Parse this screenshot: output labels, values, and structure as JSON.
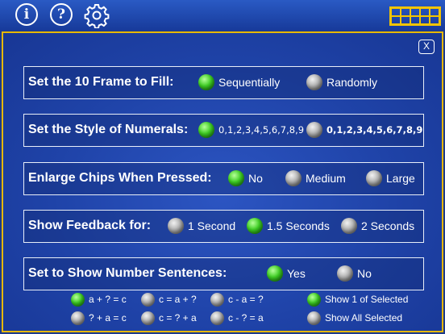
{
  "toolbar": {
    "info_label": "i",
    "help_label": "?"
  },
  "panel": {
    "close_label": "X"
  },
  "settings": [
    {
      "label": "Set the 10 Frame to Fill:",
      "options": [
        {
          "label": "Sequentially",
          "selected": true
        },
        {
          "label": "Randomly",
          "selected": false
        }
      ]
    },
    {
      "label": "Set the Style of Numerals:",
      "options": [
        {
          "label": "0,1,2,3,4,5,6,7,8,9",
          "selected": true
        },
        {
          "label": "0,1,2,3,4,5,6,7,8,9",
          "selected": false
        }
      ]
    },
    {
      "label": "Enlarge Chips When Pressed:",
      "options": [
        {
          "label": "No",
          "selected": true
        },
        {
          "label": "Medium",
          "selected": false
        },
        {
          "label": "Large",
          "selected": false
        }
      ]
    },
    {
      "label": "Show Feedback for:",
      "options": [
        {
          "label": "1 Second",
          "selected": false
        },
        {
          "label": "1.5 Seconds",
          "selected": true
        },
        {
          "label": "2 Seconds",
          "selected": false
        }
      ]
    },
    {
      "label": "Set to Show Number Sentences:",
      "options": [
        {
          "label": "Yes",
          "selected": true
        },
        {
          "label": "No",
          "selected": false
        }
      ]
    }
  ],
  "sentences": [
    {
      "label": "a + ? = c",
      "selected": true
    },
    {
      "label": "c = a + ?",
      "selected": false
    },
    {
      "label": "c - a = ?",
      "selected": false
    },
    {
      "label": "Show 1 of Selected",
      "selected": true
    },
    {
      "label": "? + a = c",
      "selected": false
    },
    {
      "label": "c = ? + a",
      "selected": false
    },
    {
      "label": "c - ? = a",
      "selected": false
    },
    {
      "label": "Show All Selected",
      "selected": false
    }
  ],
  "colors": {
    "background": "#1d3a8c",
    "panel_border": "#e6b800",
    "selected_dot": "#3fcf24",
    "unselected_dot": "#a9a9a9"
  }
}
